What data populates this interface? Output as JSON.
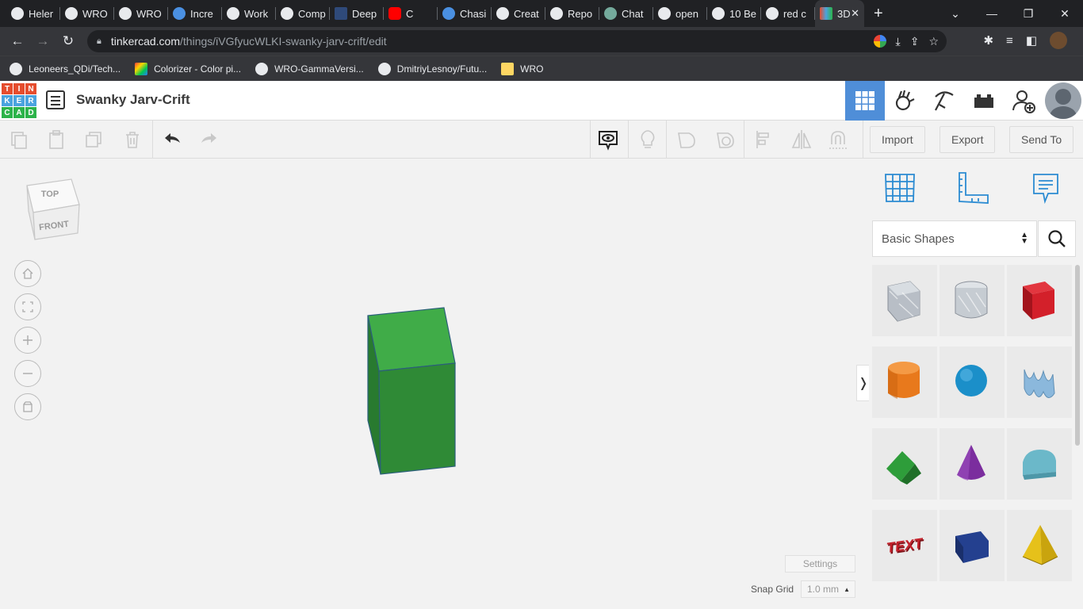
{
  "browser": {
    "tabs": [
      {
        "title": "Heler",
        "icon": "github-icon"
      },
      {
        "title": "WRO",
        "icon": "github-icon"
      },
      {
        "title": "WRO",
        "icon": "wordpress-icon"
      },
      {
        "title": "Incre",
        "icon": "pi-icon"
      },
      {
        "title": "Work",
        "icon": "github-icon"
      },
      {
        "title": "Comp",
        "icon": "page-icon"
      },
      {
        "title": "Deep",
        "icon": "tds-icon"
      },
      {
        "title": "C",
        "icon": "youtube-icon"
      },
      {
        "title": "Chasi",
        "icon": "translate-icon"
      },
      {
        "title": "Creat",
        "icon": "cc-icon"
      },
      {
        "title": "Repo",
        "icon": "github-icon"
      },
      {
        "title": "Chat",
        "icon": "openai-icon"
      },
      {
        "title": "open",
        "icon": "google-icon"
      },
      {
        "title": "10 Be",
        "icon": "medium-icon"
      },
      {
        "title": "red c",
        "icon": "google-icon"
      },
      {
        "title": "3D",
        "icon": "tinkercad-icon"
      }
    ],
    "url_host": "tinkercad.com",
    "url_path": "/things/iVGfyucWLKI-swanky-jarv-crift/edit",
    "bookmarks": [
      {
        "label": "Leoneers_QDi/Tech...",
        "icon": "github-icon"
      },
      {
        "label": "Colorizer - Color pi...",
        "icon": "colorizer-icon"
      },
      {
        "label": "WRO-GammaVersi...",
        "icon": "github-icon"
      },
      {
        "label": "DmitriyLesnoy/Futu...",
        "icon": "github-icon"
      },
      {
        "label": "WRO",
        "icon": "folder-icon"
      }
    ]
  },
  "app": {
    "logo_letters": [
      "T",
      "I",
      "N",
      "K",
      "E",
      "R",
      "C",
      "A",
      "D"
    ],
    "logo_colors": [
      "#e54d2e",
      "#e54d2e",
      "#e54d2e",
      "#4aa3df",
      "#4aa3df",
      "#4aa3df",
      "#2cb34a",
      "#2cb34a",
      "#2cb34a"
    ],
    "project_title": "Swanky Jarv-Crift",
    "accent": "#4f8ed8"
  },
  "toolbar": {
    "import_label": "Import",
    "export_label": "Export",
    "sendto_label": "Send To"
  },
  "workplane": {
    "viewcube_top": "TOP",
    "viewcube_front": "FRONT",
    "shape_color": "#2e8b3a",
    "settings_label": "Settings",
    "snap_label": "Snap Grid",
    "snap_value": "1.0 mm"
  },
  "panel": {
    "category": "Basic Shapes",
    "shapes": [
      {
        "name": "box-hole",
        "color": "#b8bec6"
      },
      {
        "name": "cylinder-hole",
        "color": "#c6ccd2"
      },
      {
        "name": "box",
        "color": "#d3202a"
      },
      {
        "name": "cylinder",
        "color": "#e8791c"
      },
      {
        "name": "sphere",
        "color": "#1b8fc9"
      },
      {
        "name": "scribble",
        "color": "#8bb8dc"
      },
      {
        "name": "roof",
        "color": "#2e9d3a"
      },
      {
        "name": "cone",
        "color": "#7b2d9e"
      },
      {
        "name": "round-roof",
        "color": "#6bb8c9"
      },
      {
        "name": "text",
        "color": "#c4202a",
        "label": "TEXT"
      },
      {
        "name": "wedge",
        "color": "#24408f"
      },
      {
        "name": "pyramid",
        "color": "#e6c11a"
      }
    ]
  }
}
